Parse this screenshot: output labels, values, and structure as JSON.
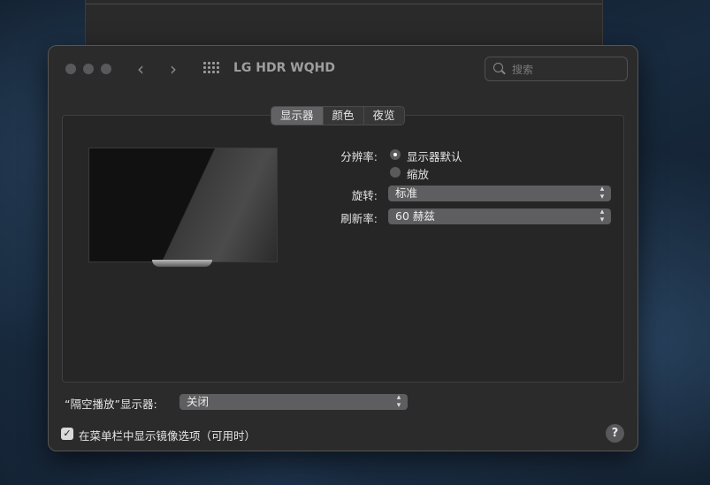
{
  "window": {
    "title": "LG HDR WQHD",
    "search_placeholder": "搜索",
    "nav_back": "‹",
    "nav_forward": "›"
  },
  "tabs": [
    {
      "label": "显示器",
      "active": true
    },
    {
      "label": "颜色",
      "active": false
    },
    {
      "label": "夜览",
      "active": false
    }
  ],
  "display": {
    "resolution_label": "分辨率:",
    "resolution_options": [
      {
        "label": "显示器默认",
        "selected": true
      },
      {
        "label": "缩放",
        "selected": false
      }
    ],
    "rotation_label": "旋转:",
    "rotation_value": "标准",
    "refresh_label": "刷新率:",
    "refresh_value": "60 赫兹"
  },
  "airplay": {
    "label": "“隔空播放”显示器:",
    "value": "关闭"
  },
  "mirror_option": {
    "label": "在菜单栏中显示镜像选项（可用时）",
    "checked": true,
    "check_glyph": "✓"
  },
  "help": {
    "label": "?"
  },
  "colors": {
    "accent": "#626264",
    "window_bg": "#2b2b2c"
  }
}
